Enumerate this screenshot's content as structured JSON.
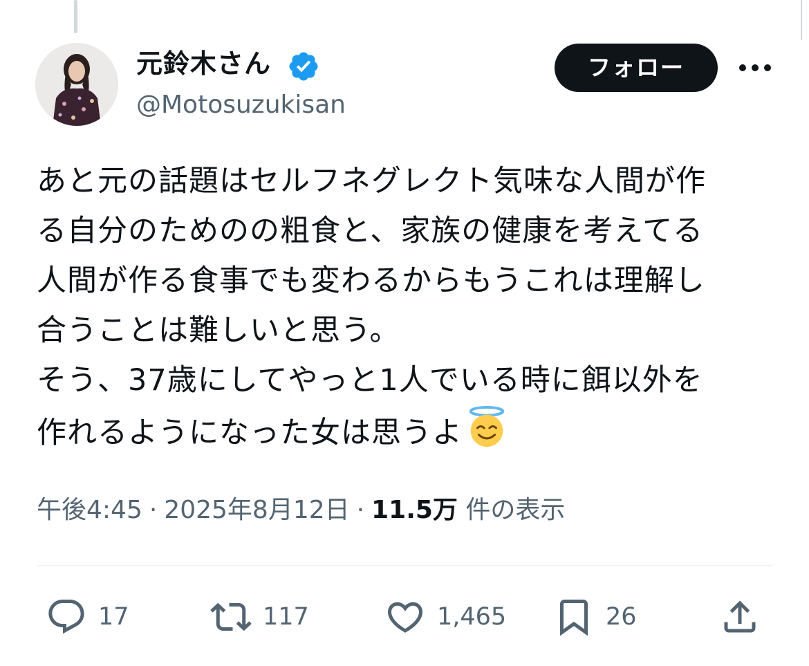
{
  "author": {
    "display_name": "元鈴木さん",
    "handle": "@Motosuzukisan",
    "verified": true,
    "verified_color": "#1d9bf0"
  },
  "follow_button": {
    "label": "フォロー"
  },
  "more_button": {
    "icon": "more-horizontal-icon"
  },
  "tweet": {
    "lines": [
      "あと元の話題はセルフネグレクト気味な人間が作",
      "る自分のためのの粗食と、家族の健康を考えてる",
      "人間が作る食事でも変わるからもうこれは理解し",
      "合うことは難しいと思う。",
      "そう、37歳にしてやっと1人でいる時に餌以外を",
      "作れるようになった女は思うよ"
    ],
    "emoji": "smiling-face-with-halo-icon"
  },
  "meta": {
    "time": "午後4:45",
    "separator": "·",
    "date": "2025年8月12日",
    "views_count": "11.5万",
    "views_label": "件の表示"
  },
  "actions": {
    "reply": {
      "icon": "reply-icon",
      "count": "17"
    },
    "retweet": {
      "icon": "retweet-icon",
      "count": "117"
    },
    "like": {
      "icon": "heart-icon",
      "count": "1,465"
    },
    "bookmark": {
      "icon": "bookmark-icon",
      "count": "26"
    },
    "share": {
      "icon": "share-icon"
    }
  },
  "colors": {
    "text_primary": "#0f1419",
    "text_secondary": "#536471",
    "button_bg": "#0f1419",
    "divider": "#eff3f4"
  }
}
